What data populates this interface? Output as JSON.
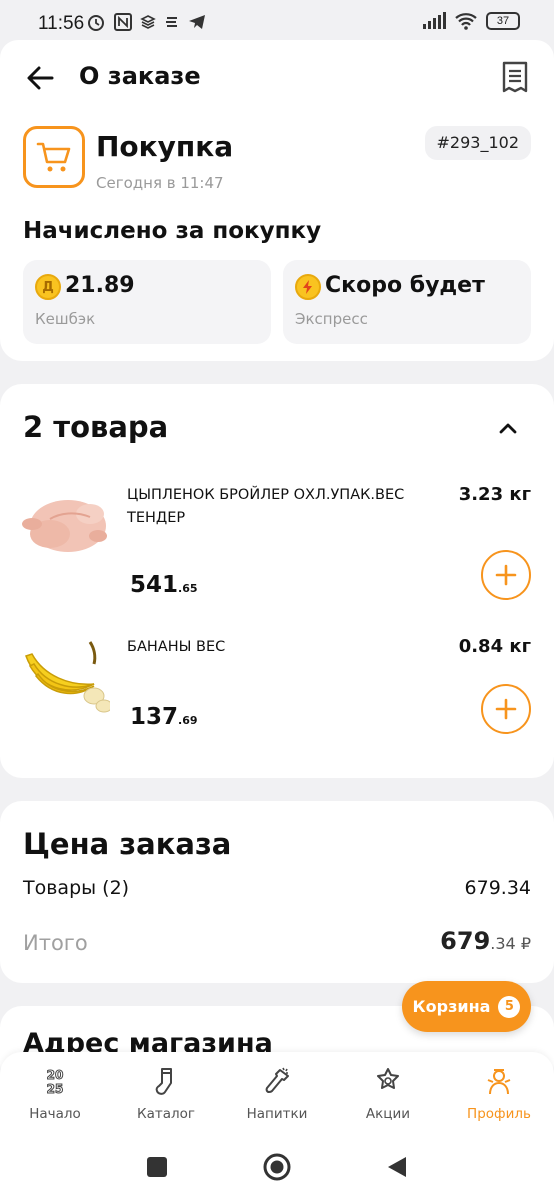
{
  "status_bar": {
    "time": "11:56",
    "battery": "37"
  },
  "header": {
    "title": "О заказе"
  },
  "order": {
    "type": "Покупка",
    "date": "Сегодня в 11:47",
    "number": "#293_102",
    "accrued_title": "Начислено за покупку",
    "cashback": {
      "value": "21.89",
      "label": "Кешбэк",
      "icon_letter": "Д"
    },
    "express": {
      "value": "Скоро будет",
      "label": "Экспресс"
    }
  },
  "items": {
    "title": "2 товара",
    "list": [
      {
        "name": "ЦЫПЛЕНОК БРОЙЛЕР ОХЛ.УПАК.ВЕС ТЕНДЕР",
        "weight": "3.23 кг",
        "price_main": "541",
        "price_cents": ".65",
        "image": "chicken"
      },
      {
        "name": "БАНАНЫ ВЕС",
        "weight": "0.84 кг",
        "price_main": "137",
        "price_cents": ".69",
        "image": "bananas"
      }
    ]
  },
  "price": {
    "title": "Цена заказа",
    "goods_label": "Товары (2)",
    "goods_value": "679.34",
    "total_label": "Итого",
    "total_main": "679",
    "total_cents": ".34 ₽"
  },
  "address": {
    "title": "Адрес магазина"
  },
  "cart_fab": {
    "label": "Корзина",
    "count": "5"
  },
  "bottom_nav": {
    "items": [
      {
        "label": "Начало",
        "icon": "year-2025-icon"
      },
      {
        "label": "Каталог",
        "icon": "sock-icon"
      },
      {
        "label": "Напитки",
        "icon": "champagne-icon"
      },
      {
        "label": "Акции",
        "icon": "star-wreath-icon"
      },
      {
        "label": "Профиль",
        "icon": "snowman-icon",
        "active": true
      }
    ]
  },
  "colors": {
    "accent": "#f7941d",
    "background": "#f1f1f3",
    "card": "#ffffff",
    "muted_text": "#9a9a9a"
  }
}
